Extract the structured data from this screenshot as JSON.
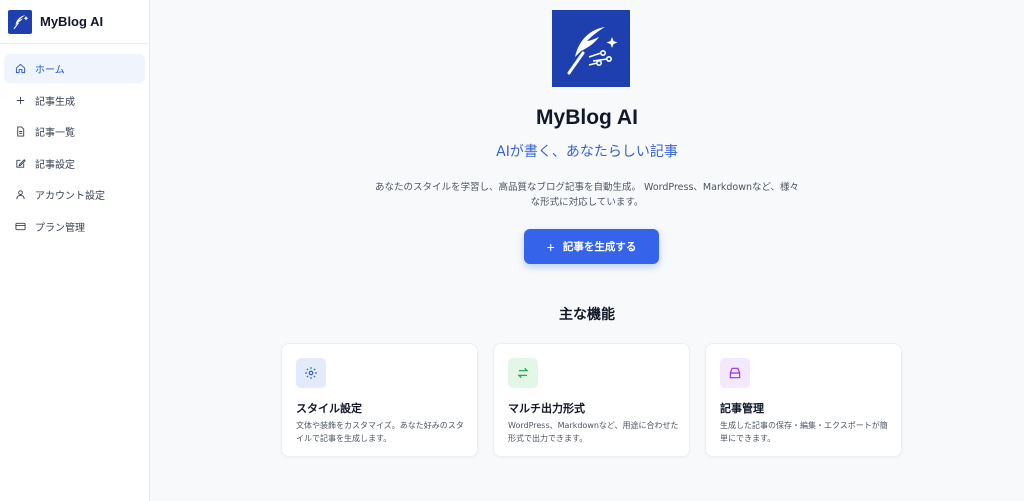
{
  "brand": {
    "name": "MyBlog AI"
  },
  "nav": {
    "items": [
      {
        "label": "ホーム",
        "icon": "home-icon"
      },
      {
        "label": "記事生成",
        "icon": "plus-icon"
      },
      {
        "label": "記事一覧",
        "icon": "document-icon"
      },
      {
        "label": "記事設定",
        "icon": "edit-icon"
      },
      {
        "label": "アカウント設定",
        "icon": "user-icon"
      },
      {
        "label": "プラン管理",
        "icon": "card-icon"
      }
    ],
    "active_index": 0
  },
  "hero": {
    "title": "MyBlog AI",
    "tagline": "AIが書く、あなたらしい記事",
    "description": "あなたのスタイルを学習し、高品質なブログ記事を自動生成。 WordPress、Markdownなど、様々な形式に対応しています。",
    "cta_label": "記事を生成する"
  },
  "features": {
    "title": "主な機能",
    "cards": [
      {
        "title": "スタイル設定",
        "desc": "文体や装飾をカスタマイズ。あなた好みのスタイルで記事を生成します。",
        "icon": "gear-icon",
        "color": "#2b59c3",
        "bg": "#e3ebfb"
      },
      {
        "title": "マルチ出力形式",
        "desc": "WordPress、Markdownなど、用途に合わせた形式で出力できます。",
        "icon": "swap-arrows-icon",
        "color": "#16a34a",
        "bg": "#e3f7e8"
      },
      {
        "title": "記事管理",
        "desc": "生成した記事の保存・編集・エクスポートが簡単にできます。",
        "icon": "archive-icon",
        "color": "#9333ea",
        "bg": "#f3e8fd"
      }
    ]
  },
  "colors": {
    "accent": "#3563e9",
    "brand": "#1e3fae"
  }
}
